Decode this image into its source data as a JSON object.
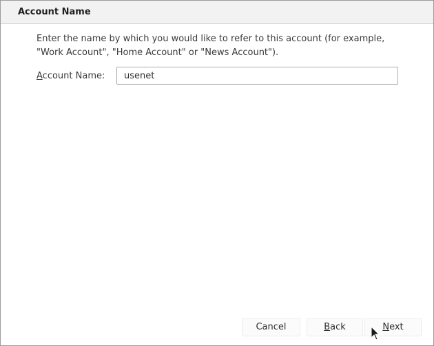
{
  "header": {
    "title": "Account Name"
  },
  "main": {
    "description": "Enter the name by which you would like to refer to this account (for example, \"Work Account\", \"Home Account\" or \"News Account\").",
    "account_name_label": {
      "accesskey": "A",
      "rest": "ccount Name:"
    },
    "account_name_value": "usenet"
  },
  "footer": {
    "cancel_label": "Cancel",
    "back_label": {
      "accesskey": "B",
      "rest": "ack"
    },
    "next_label": {
      "accesskey": "N",
      "rest": "ext"
    }
  },
  "icons": {
    "cursor": "mouse-pointer-icon"
  }
}
